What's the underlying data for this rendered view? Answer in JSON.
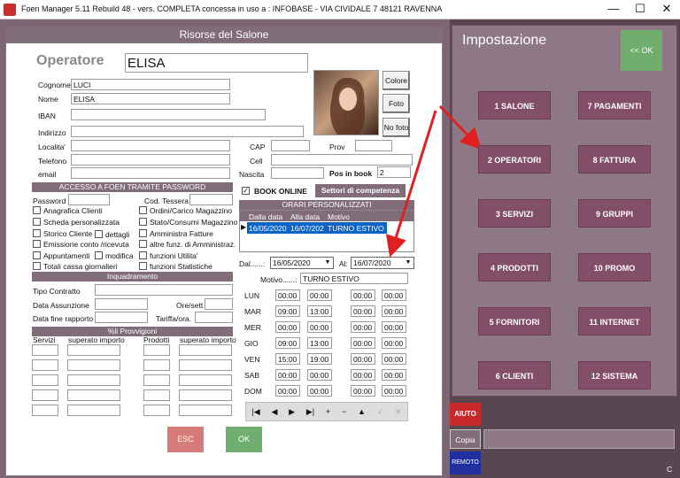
{
  "window": {
    "title": "Foen Manager 5.11 Rebuild 48 - vers. COMPLETA concessa in uso a : INFOBASE - VIA CIVIDALE 7 48121 RAVENNA",
    "minimize": "—",
    "maximize": "☐",
    "close": "✕"
  },
  "panel": {
    "title": "Risorse del Salone"
  },
  "operatore": {
    "label": "Operatore",
    "value": "ELISA"
  },
  "fields": {
    "cognome_label": "Cognome",
    "cognome": "LUCI",
    "nome_label": "Nome",
    "nome": "ELISA",
    "iban_label": "IBAN",
    "indirizzo_label": "Indirizzo",
    "localita_label": "Localita'",
    "cap_label": "CAP",
    "prov_label": "Prov",
    "telefono_label": "Telefono",
    "cell_label": "Cell",
    "email_label": "email",
    "nascita_label": "Nascita",
    "posinbook_label": "Pos in book",
    "posinbook": "2"
  },
  "photo_buttons": {
    "colore": "Colore",
    "foto": "Foto",
    "nofoto": "No foto"
  },
  "accesso": {
    "title": "ACCESSO A FOEN TRAMITE PASSWORD",
    "password_label": "Password",
    "tessera_label": "Cod. Tessera"
  },
  "permessi_left": [
    "Anagrafica Clienti",
    "Scheda personalizzata",
    "Storico Cliente",
    "Emissione conto /ricevuta",
    "Appuntamenti",
    "Totali cassa giornalieri"
  ],
  "permessi_right": [
    "Ordini/Carico Magazzino",
    "Stato/Consumi Magazzino",
    "Amministra Fatture",
    "altre funz. di Amministraz.",
    "funzioni Utilita'",
    "funzioni Statistiche"
  ],
  "permessi_extra": {
    "dettagli": "dettagli",
    "modifica": "modifica"
  },
  "inquadramento": {
    "title": "Inquadramento",
    "tipo_contratto": "Tipo Contratto",
    "data_assunzione": "Data Assunzione",
    "ore_sett": "Ore/sett",
    "data_fine": "Data fine rapporto",
    "tariffa": "Tariffa/ora."
  },
  "provvigioni": {
    "title": "%li Provvigioni",
    "servizi": "Servizi",
    "superato1": "superato importo",
    "prodotti": "Prodotti",
    "superato2": "superato importo"
  },
  "book": {
    "book_online": "BOOK ONLINE",
    "settori": "Settori di competenza"
  },
  "orari": {
    "title": "ORARI PERSONALIZZATI",
    "col_dal": "Dalla data",
    "col_al": "Alla data",
    "col_motivo": "Motivo",
    "row": {
      "dal": "16/05/2020",
      "al": "16/07/202",
      "motivo": "TURNO ESTIVO"
    },
    "dal_label": "Dal......:",
    "dal_value": "16/05/2020",
    "al_label": "Al:",
    "al_value": "16/07/2020",
    "motivo_label": "Motivo......:",
    "motivo_value": "TURNO ESTIVO"
  },
  "days": [
    {
      "d": "LUN",
      "t": [
        "00:00",
        "00:00",
        "00:00",
        "00:00"
      ]
    },
    {
      "d": "MAR",
      "t": [
        "09:00",
        "13:00",
        "00:00",
        "00:00"
      ]
    },
    {
      "d": "MER",
      "t": [
        "00:00",
        "00:00",
        "00:00",
        "00:00"
      ]
    },
    {
      "d": "GIO",
      "t": [
        "09:00",
        "13:00",
        "00:00",
        "00:00"
      ]
    },
    {
      "d": "VEN",
      "t": [
        "15:00",
        "19:00",
        "00:00",
        "00:00"
      ]
    },
    {
      "d": "SAB",
      "t": [
        "00:00",
        "00:00",
        "00:00",
        "00:00"
      ]
    },
    {
      "d": "DOM",
      "t": [
        "00:00",
        "00:00",
        "00:00",
        "00:00"
      ]
    }
  ],
  "nav": [
    "|◀",
    "◀",
    "▶",
    "▶|",
    "+",
    "−",
    "▲",
    "✓",
    "✕"
  ],
  "actions": {
    "esc": "ESC",
    "ok": "OK"
  },
  "impostazione": {
    "title": "Impostazione",
    "ok": "<< OK"
  },
  "menu": [
    "1 SALONE",
    "7 PAGAMENTI",
    "2 OPERATORI",
    "8 FATTURA",
    "3 SERVIZI",
    "9 GRUPPI",
    "4 PRODOTTI",
    "10 PROMO",
    "5 FORNITORI",
    "11 INTERNET",
    "6 CLIENTI",
    "12 SISTEMA"
  ],
  "bottom": {
    "aiuto": "AIUTO",
    "copia": "Copia",
    "remoto": "REMOTO",
    "c": "C"
  },
  "colors": {
    "accent": "#816c79",
    "menu": "#824e68",
    "ok": "#6fae6f",
    "esc": "#d77a7a",
    "arrow": "#e02020"
  }
}
